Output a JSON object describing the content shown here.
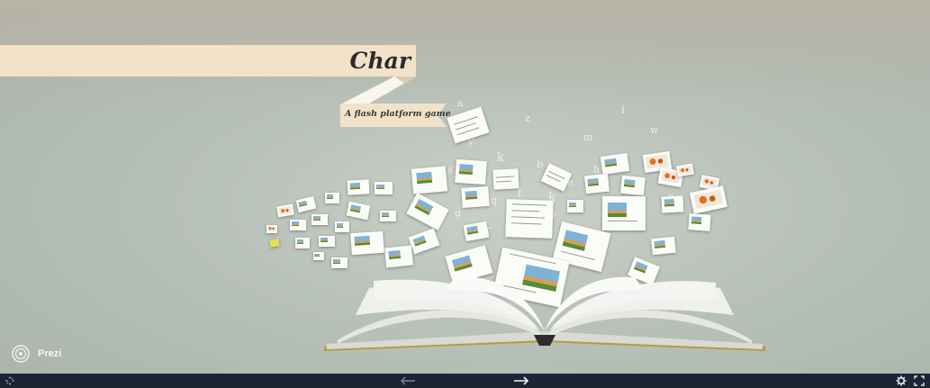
{
  "presentation": {
    "title": "Char",
    "subtitle": "A flash platform game"
  },
  "scattered_letters": [
    "a",
    "z",
    "i",
    "m",
    "w",
    "y",
    "k",
    "b",
    "h",
    "s",
    "e",
    "k",
    "f",
    "q",
    "r",
    "g",
    "c",
    "n",
    "b"
  ],
  "branding": {
    "logo_text": "Prezi",
    "logo_icon": "prezi-logo-icon"
  },
  "toolbar": {
    "loading_icon": "spinner-icon",
    "prev_icon": "arrow-left-icon",
    "next_icon": "arrow-right-icon",
    "settings_icon": "gear-icon",
    "fullscreen_icon": "fullscreen-icon"
  },
  "colors": {
    "banner": "#f2e2ca",
    "toolbar": "#1d2535",
    "title_text": "#2b2b2b"
  }
}
